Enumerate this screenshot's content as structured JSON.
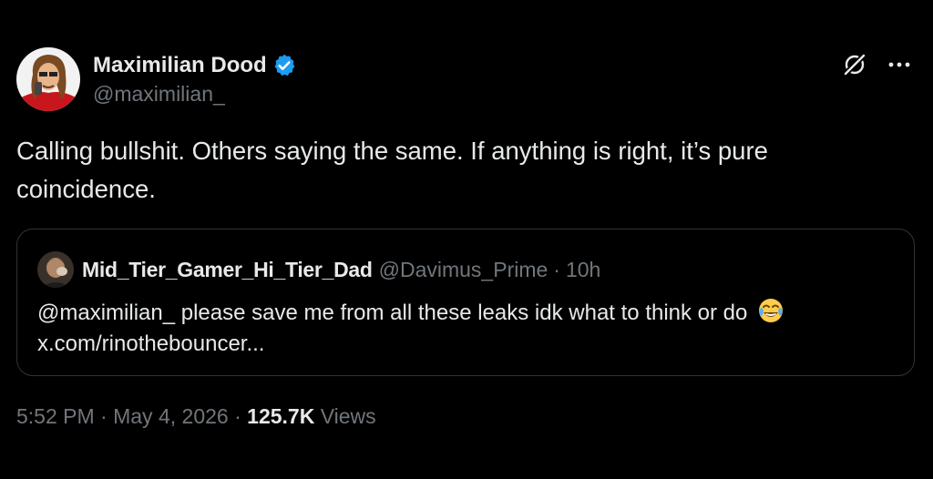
{
  "tweet": {
    "author": {
      "display_name": "Maximilian Dood",
      "handle": "@maximilian_",
      "verified": true,
      "verified_color": "#1d9bf0"
    },
    "text_line1": "Calling bullshit. Others saying the same. If anything is right, it’s pure",
    "text_line2": "coincidence.",
    "quoted": {
      "display_name": "Mid_Tier_Gamer_Hi_Tier_Dad",
      "handle": "@Davimus_Prime",
      "separator": "·",
      "time": "10h",
      "text_line1": "@maximilian_  please save me from all these leaks idk what to think or do",
      "emoji": "face-with-tears-of-joy",
      "text_line2": "x.com/rinothebouncer..."
    },
    "meta": {
      "time": "5:52 PM",
      "sep1": " · ",
      "date": "May 4, 2026",
      "sep2": " · ",
      "views_count": "125.7K",
      "views_label": " Views"
    },
    "icons": {
      "grok": "grok-icon",
      "more": "more-icon"
    },
    "colors": {
      "background": "#000000",
      "text": "#e7e9ea",
      "secondary": "#71767b",
      "border": "#2f3336"
    }
  }
}
